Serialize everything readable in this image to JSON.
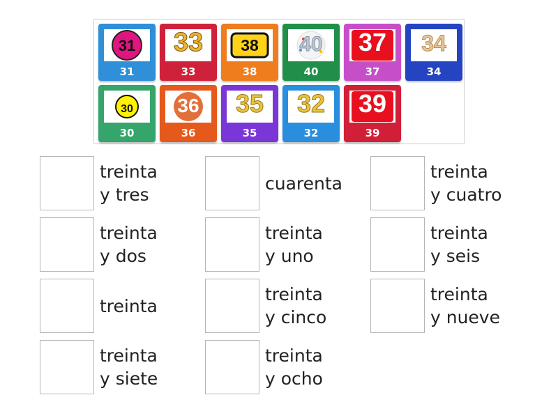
{
  "tiles": [
    {
      "num": "31",
      "caption": "31",
      "color": "#2f8fd8",
      "art": "magenta-circle-number"
    },
    {
      "num": "33",
      "caption": "33",
      "color": "#d0213a",
      "art": "gold-text-number"
    },
    {
      "num": "38",
      "caption": "38",
      "color": "#f07d1c",
      "art": "yellow-rounded-box-number"
    },
    {
      "num": "40",
      "caption": "40",
      "color": "#208f4a",
      "art": "confetti-balloon-number"
    },
    {
      "num": "37",
      "caption": "37",
      "color": "#c64fc8",
      "art": "red-tile-number"
    },
    {
      "num": "34",
      "caption": "34",
      "color": "#2544c2",
      "art": "gold-balloon-number"
    },
    {
      "num": "30",
      "caption": "30",
      "color": "#35a56b",
      "art": "yellow-coin-number"
    },
    {
      "num": "36",
      "caption": "36",
      "color": "#e55a1c",
      "art": "orange-circle-number"
    },
    {
      "num": "35",
      "caption": "35",
      "color": "#7b36d8",
      "art": "gold-glitter-number"
    },
    {
      "num": "32",
      "caption": "32",
      "color": "#2a8edf",
      "art": "gold-glitter-number"
    },
    {
      "num": "39",
      "caption": "39",
      "color": "#d21f38",
      "art": "red-tile-number"
    }
  ],
  "targets": [
    {
      "label": "treinta\ny tres"
    },
    {
      "label": "cuarenta"
    },
    {
      "label": "treinta\ny cuatro"
    },
    {
      "label": "treinta\ny dos"
    },
    {
      "label": "treinta\ny uno"
    },
    {
      "label": "treinta\ny seis"
    },
    {
      "label": "treinta"
    },
    {
      "label": "treinta\ny cinco"
    },
    {
      "label": "treinta\ny nueve"
    },
    {
      "label": "treinta\ny siete"
    },
    {
      "label": "treinta\ny ocho"
    }
  ]
}
